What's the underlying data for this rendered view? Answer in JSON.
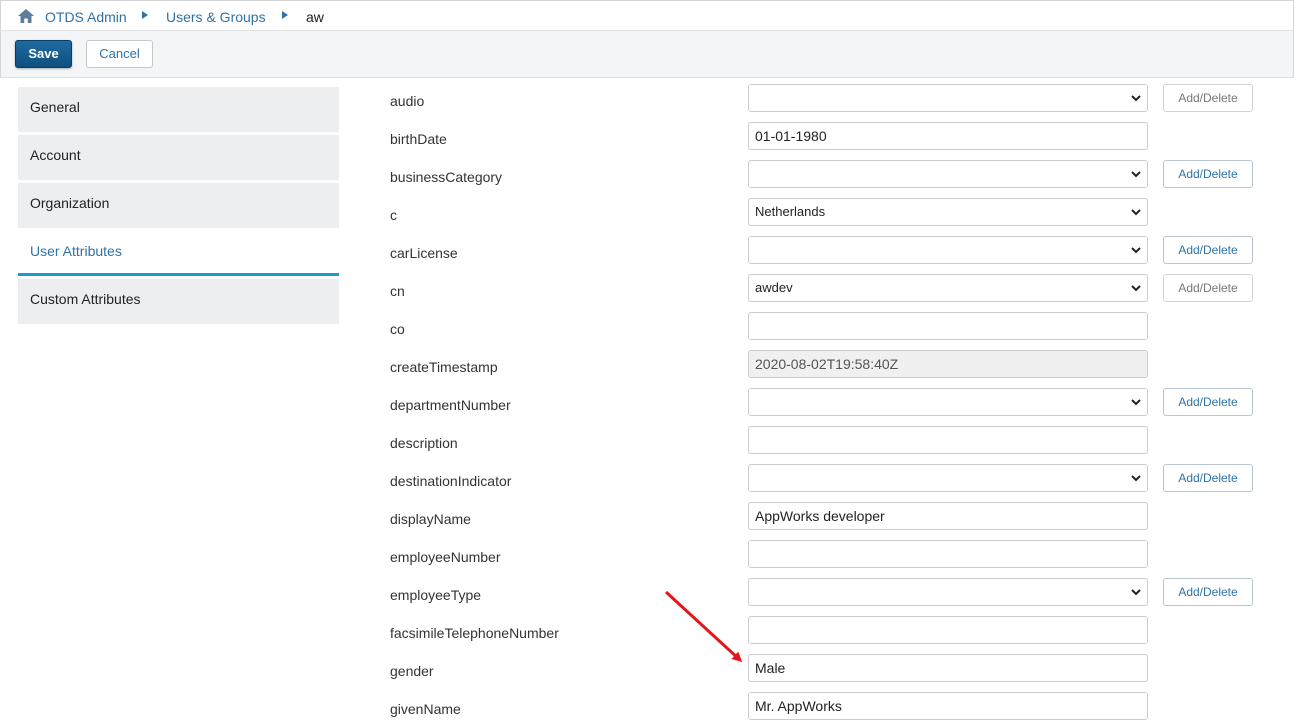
{
  "breadcrumb": {
    "home_icon": "home-icon",
    "items": [
      "OTDS Admin",
      "Users & Groups",
      "aw"
    ]
  },
  "toolbar": {
    "save_label": "Save",
    "cancel_label": "Cancel"
  },
  "sidebar": {
    "items": [
      {
        "label": "General"
      },
      {
        "label": "Account"
      },
      {
        "label": "Organization"
      },
      {
        "label": "User Attributes",
        "active": true
      },
      {
        "label": "Custom Attributes"
      }
    ]
  },
  "attributes": [
    {
      "name": "audio",
      "type": "select",
      "value": "",
      "button": "Add/Delete",
      "button_state": "disabled"
    },
    {
      "name": "birthDate",
      "type": "text",
      "value": "01-01-1980"
    },
    {
      "name": "businessCategory",
      "type": "select",
      "value": "",
      "button": "Add/Delete",
      "button_state": "enabled"
    },
    {
      "name": "c",
      "type": "select",
      "value": "Netherlands"
    },
    {
      "name": "carLicense",
      "type": "select",
      "value": "",
      "button": "Add/Delete",
      "button_state": "enabled"
    },
    {
      "name": "cn",
      "type": "select",
      "value": "awdev",
      "button": "Add/Delete",
      "button_state": "disabled"
    },
    {
      "name": "co",
      "type": "text",
      "value": ""
    },
    {
      "name": "createTimestamp",
      "type": "readonly",
      "value": "2020-08-02T19:58:40Z"
    },
    {
      "name": "departmentNumber",
      "type": "select",
      "value": "",
      "button": "Add/Delete",
      "button_state": "enabled"
    },
    {
      "name": "description",
      "type": "text",
      "value": ""
    },
    {
      "name": "destinationIndicator",
      "type": "select",
      "value": "",
      "button": "Add/Delete",
      "button_state": "enabled"
    },
    {
      "name": "displayName",
      "type": "text",
      "value": "AppWorks developer"
    },
    {
      "name": "employeeNumber",
      "type": "text",
      "value": ""
    },
    {
      "name": "employeeType",
      "type": "select",
      "value": "",
      "button": "Add/Delete",
      "button_state": "enabled"
    },
    {
      "name": "facsimileTelephoneNumber",
      "type": "text",
      "value": ""
    },
    {
      "name": "gender",
      "type": "text",
      "value": "Male"
    },
    {
      "name": "givenName",
      "type": "text",
      "value": "Mr. AppWorks"
    }
  ],
  "annotation": {
    "icon": "red-arrow-icon",
    "color": "#e8141b"
  },
  "colors": {
    "link": "#2e73a8",
    "save_button": "#145d92",
    "active_tab_underline": "#16a0c8"
  }
}
